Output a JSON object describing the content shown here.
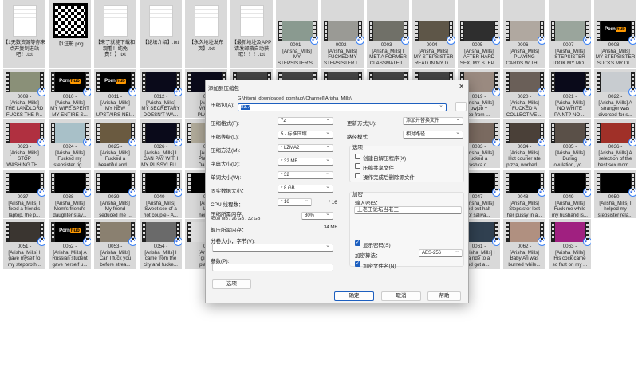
{
  "tiles": [
    {
      "k": "doc",
      "t": "【1无数资源等你来 点开复制进站吧！.txt"
    },
    {
      "k": "qr",
      "t": "【1注册.png"
    },
    {
      "k": "doc",
      "t": "【来了就能下载和观看！纯免费！】.txt"
    },
    {
      "k": "doc",
      "t": "【论坛介绍】.txt"
    },
    {
      "k": "doc",
      "t": "【永久地址发布页】.txt"
    },
    {
      "k": "doc",
      "t": "【最新地址及APP请发邮箱自动获取！！！.txt"
    },
    {
      "c": "#8a9a90",
      "t": "0001 -\n[Arisha_Mills]\nMY\nSTEPSISTER'S..."
    },
    {
      "c": "#9a9a95",
      "t": "0002 -\n[Arisha_Mills]\nFUCKED MY\nSTEPSISTER I..."
    },
    {
      "c": "#707068",
      "t": "0003 -\n[Arisha_Mills] I\nMET A FORMER\nCLASSMATE I..."
    },
    {
      "c": "#5e5648",
      "t": "0004 -\n[Arisha_Mills]\nMY STEPSISTER\nREAD IN MY D..."
    },
    {
      "c": "#2e2e2e",
      "t": "0005 -\n[Arisha_Mills]\nAFTER HARD\nSEX, MY STEP..."
    },
    {
      "c": "#b0a8a0",
      "t": "0006 -\n[Arisha_Mills]\nPLAYING\nCARDS WITH ..."
    },
    {
      "c": "#9aa59c",
      "t": "0007 -\n[Arisha_Mills]\nSTEPSISTER\nTOOK MY MO..."
    },
    {
      "c": "#000",
      "logo": 1,
      "t": "0008 -\n[Arisha_Mills]\nMY STEPSISTER\nSUCKS MY DI..."
    },
    {
      "c": "#8a9078",
      "t": "0009 -\n[Arisha_Mills]\nTHE LANDLORD\nFUCKS THE P..."
    },
    {
      "c": "#000",
      "logo": 1,
      "t": "0010 -\n[Arisha_Mills]\nMY WIFE SPENT\nMY ENTIRE S..."
    },
    {
      "c": "#000",
      "logo": 1,
      "t": "0011 -\n[Arisha_Mills]\nMY NEW\nUPSTAIRS NEI..."
    },
    {
      "c": "#0a0a1a",
      "t": "0012 -\n[Arisha_Mills]\nMY SECRETARY\nDOESN'T WA..."
    },
    {
      "c": "#0a0a1a",
      "t": "00\n[Arish\nWHILI\nPLAYIN"
    },
    {
      "c": "#444",
      "t": ""
    },
    {
      "c": "#444",
      "t": ""
    },
    {
      "c": "#444",
      "t": ""
    },
    {
      "c": "#444",
      "t": ""
    },
    {
      "c": "#444",
      "t": ""
    },
    {
      "c": "#9a8a80",
      "t": "0019 -\n[Arisha_Mills]\nowjob +\nob from ..."
    },
    {
      "c": "#6a5f58",
      "t": "0020 -\n[Arisha_Mills]\nFUCKED A\nCOLLECTIVE ..."
    },
    {
      "c": "#0a0a1a",
      "t": "0021 -\n[Arisha_Mills]\nNO WHITE\nPAINT?  NO ..."
    },
    {
      "c": "#c8ccd0",
      "t": "0022 -\n[Arisha_Mills] A\nstranger was\ndivorced for s..."
    },
    {
      "c": "#b03040",
      "t": "0023 -\n[Arisha_Mills]\nSTOP\nWASHING TH..."
    },
    {
      "c": "#a8c0c8",
      "t": "0024 -\n[Arisha_Mills]\nFucked my\nstepsister rig..."
    },
    {
      "c": "#6a5a40",
      "t": "0025 -\n[Arisha_Mills]\nFucked a\nbeautiful and ..."
    },
    {
      "c": "#0a0a1a",
      "t": "0026 -\n[Arisha_Mills] I\nCAN PAY WITH\nMY PUSSY! FU..."
    },
    {
      "c": "#b0aa9a",
      "t": "00\n[Arish\nPlayed\nDare w"
    },
    {
      "c": "#444",
      "t": ""
    },
    {
      "c": "#444",
      "t": ""
    },
    {
      "c": "#444",
      "t": ""
    },
    {
      "c": "#444",
      "t": ""
    },
    {
      "c": "#444",
      "t": ""
    },
    {
      "c": "#7a6a60",
      "t": "0033 -\n[Arisha_Mills]\nucked a\nyashka d..."
    },
    {
      "c": "#4a4038",
      "t": "0034 -\n[Arisha_Mills]\nHot courier ate\npizza, worked ..."
    },
    {
      "c": "#5a5048",
      "t": "0035 -\n[Arisha_Mills]\nDuring\novulation, yo..."
    },
    {
      "c": "#a03028",
      "t": "0036 -\n[Arisha_Mills] A\nselection of the\nbest sex mom..."
    },
    {
      "c": "#000",
      "t": "0037 -\n[Arisha_Mills] I\nfixed a friend's\nlaptop, the p..."
    },
    {
      "c": "#000",
      "t": "0038 -\n[Arisha_Mills]\nMom's friend's\ndaughter stay..."
    },
    {
      "c": "#000",
      "t": "0039 -\n[Arisha_Mills]\nMy friend\nseduced me ..."
    },
    {
      "c": "#000",
      "t": "0040 -\n[Arisha_Mills]\nSweet sex of a\nhot couple - A..."
    },
    {
      "c": "#000",
      "t": "00\n[Arish\nLu\nneighb"
    },
    {
      "c": "#444",
      "t": ""
    },
    {
      "c": "#444",
      "t": ""
    },
    {
      "c": "#444",
      "t": ""
    },
    {
      "c": "#444",
      "t": ""
    },
    {
      "c": "#444",
      "t": ""
    },
    {
      "c": "#000",
      "t": "0047 -\n[Arisha_Mills]\ned out half\nof saliva..."
    },
    {
      "c": "#000",
      "t": "0048 -\n[Arisha_Mills]\nStepsister lost\nher pussy in a..."
    },
    {
      "c": "#000",
      "t": "0049 -\n[Arisha_Mills]\nFuck me while\nmy husband is..."
    },
    {
      "c": "#000",
      "t": "0050 -\n[Arisha_Mills] I\nhelped my\nstepsister rela..."
    },
    {
      "c": "#3a3530",
      "t": "0051 -\n[Arisha_Mills] I\ngave myself to\nmy stepbroth..."
    },
    {
      "c": "#000",
      "logo": 1,
      "t": "0052 -\n[Arisha_Mills] A\nRussian student\ngave herself u..."
    },
    {
      "c": "#8a8070",
      "t": "0053 -\n[Arisha_Mills]\nCan I fuck you\nbefore strea..."
    },
    {
      "c": "#6a6a6a",
      "t": "0054 -\n[Arisha_Mills] I\ncame from the\ncity and fucke..."
    },
    {
      "c": "#e0e0e0",
      "t": "00\n[Arisha\ngirl fr\nplanet"
    },
    {
      "c": "#444",
      "t": ""
    },
    {
      "c": "#444",
      "t": ""
    },
    {
      "c": "#444",
      "t": ""
    },
    {
      "c": "#444",
      "t": ""
    },
    {
      "c": "#444",
      "t": ""
    },
    {
      "c": "#304050",
      "t": "0061 -\n[Arisha_Mills] I\na ride to a\nnd got a ..."
    },
    {
      "c": "#b09080",
      "t": "0062 -\n[Arisha_Mills]\nBaby Ari was\nburned while..."
    },
    {
      "c": "#a02080",
      "t": "0063 -\n[Arisha_Mills]\nHis cock came\nso fast on my ..."
    }
  ],
  "logo": {
    "a": "Porn",
    "b": "hub"
  },
  "dialog": {
    "title": "添加到压缩包",
    "close": "✕",
    "archive_label": "压缩包(A):",
    "archive_path": "G:\\hitomi_downloaded_pornhub\\[Channel] Arisha_Mills\\",
    "archive_name": "83.7",
    "browse": "...",
    "format_label": "压缩格式(F):",
    "format": "7z",
    "level_label": "压缩等级(L):",
    "level": "5 - 标准压缩",
    "method_label": "压缩方法(M):",
    "method": "* LZMA2",
    "dict_label": "字典大小(D):",
    "dict": "* 32 MB",
    "word_label": "单词大小(W):",
    "word": "* 32",
    "solid_label": "固实数据大小：",
    "solid": "* 8 GB",
    "cpu_label": "CPU 线程数：",
    "cpu": "* 16",
    "cpu_total": "/ 16",
    "mem_label": "压缩所需内存：",
    "mem_detail": "4508 MB / 26 GB / 32 GB",
    "mem_pct": "80%",
    "dmem_label": "解压所需内存：",
    "dmem": "34 MB",
    "split_label": "分卷大小，字节(V):",
    "split": "",
    "params_label": "参数(P):",
    "params": "",
    "options_btn": "选项",
    "update_label": "更新方式(U):",
    "update": "添加并替换文件",
    "pathmode_label": "路径模式",
    "pathmode": "相对路径",
    "opts_title": "选项",
    "opt1": "创建自解压程序(X)",
    "opt2": "压缩共享文件",
    "opt3": "操作完成后删除源文件",
    "enc_title": "加密",
    "pwd_label": "输入密码：",
    "pwd": "上老王论坛当老王",
    "show_pwd": "显示密码(S)",
    "enc_method_label": "加密算法：",
    "enc_method": "AES-256",
    "enc_names": "加密文件名(N)",
    "ok": "确定",
    "cancel": "取消",
    "help": "帮助"
  }
}
